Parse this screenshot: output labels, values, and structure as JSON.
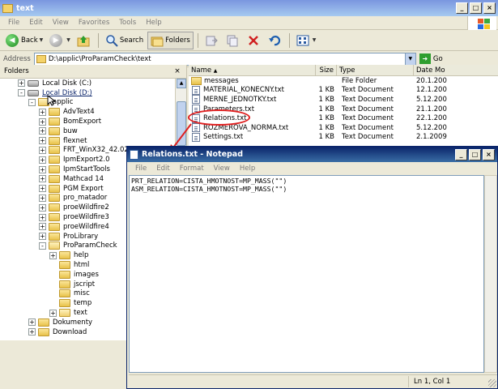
{
  "explorer": {
    "title": "text",
    "menu": [
      "File",
      "Edit",
      "View",
      "Favorites",
      "Tools",
      "Help"
    ],
    "toolbar": {
      "back_label": "Back",
      "search_label": "Search",
      "folders_label": "Folders"
    },
    "address": {
      "label": "Address",
      "value": "D:\\applic\\ProParamCheck\\text",
      "go_label": "Go"
    },
    "folders_pane": {
      "title": "Folders",
      "tree": [
        {
          "label": "Local Disk (C:)",
          "indent": 0,
          "exp": "+",
          "icon": "disk"
        },
        {
          "label": "Local Disk (D:)",
          "indent": 0,
          "exp": "-",
          "icon": "disk",
          "selected": true
        },
        {
          "label": "applic",
          "indent": 1,
          "exp": "-",
          "icon": "folder-open"
        },
        {
          "label": "AdvText4",
          "indent": 2,
          "exp": "+",
          "icon": "folder"
        },
        {
          "label": "BomExport",
          "indent": 2,
          "exp": "+",
          "icon": "folder"
        },
        {
          "label": "buw",
          "indent": 2,
          "exp": "+",
          "icon": "folder"
        },
        {
          "label": "flexnet",
          "indent": 2,
          "exp": "+",
          "icon": "folder"
        },
        {
          "label": "FRT_WinX32_42.02",
          "indent": 2,
          "exp": "+",
          "icon": "folder"
        },
        {
          "label": "IpmExport2.0",
          "indent": 2,
          "exp": "+",
          "icon": "folder"
        },
        {
          "label": "IpmStartTools",
          "indent": 2,
          "exp": "+",
          "icon": "folder"
        },
        {
          "label": "Mathcad 14",
          "indent": 2,
          "exp": "+",
          "icon": "folder"
        },
        {
          "label": "PGM Export",
          "indent": 2,
          "exp": "+",
          "icon": "folder"
        },
        {
          "label": "pro_matador",
          "indent": 2,
          "exp": "+",
          "icon": "folder"
        },
        {
          "label": "proeWildfire2",
          "indent": 2,
          "exp": "+",
          "icon": "folder"
        },
        {
          "label": "proeWildfire3",
          "indent": 2,
          "exp": "+",
          "icon": "folder"
        },
        {
          "label": "proeWildfire4",
          "indent": 2,
          "exp": "+",
          "icon": "folder"
        },
        {
          "label": "ProLibrary",
          "indent": 2,
          "exp": "+",
          "icon": "folder"
        },
        {
          "label": "ProParamCheck",
          "indent": 2,
          "exp": "-",
          "icon": "folder-open"
        },
        {
          "label": "help",
          "indent": 3,
          "exp": "+",
          "icon": "folder"
        },
        {
          "label": "html",
          "indent": 3,
          "exp": "",
          "icon": "folder"
        },
        {
          "label": "images",
          "indent": 3,
          "exp": "",
          "icon": "folder"
        },
        {
          "label": "jscript",
          "indent": 3,
          "exp": "",
          "icon": "folder"
        },
        {
          "label": "misc",
          "indent": 3,
          "exp": "",
          "icon": "folder"
        },
        {
          "label": "temp",
          "indent": 3,
          "exp": "",
          "icon": "folder"
        },
        {
          "label": "text",
          "indent": 3,
          "exp": "+",
          "icon": "folder-open"
        },
        {
          "label": "Dokumenty",
          "indent": 1,
          "exp": "+",
          "icon": "folder"
        },
        {
          "label": "Download",
          "indent": 1,
          "exp": "+",
          "icon": "folder"
        }
      ]
    },
    "file_list": {
      "columns": [
        "Name",
        "Size",
        "Type",
        "Date Mo"
      ],
      "files": [
        {
          "name": "messages",
          "size": "",
          "type": "File Folder",
          "date": "20.1.200",
          "kind": "folder"
        },
        {
          "name": "MATERIAL_KONECNY.txt",
          "size": "1 KB",
          "type": "Text Document",
          "date": "12.1.200",
          "kind": "doc"
        },
        {
          "name": "MERNE_JEDNOTKY.txt",
          "size": "1 KB",
          "type": "Text Document",
          "date": "5.12.200",
          "kind": "doc"
        },
        {
          "name": "Parameters.txt",
          "size": "1 KB",
          "type": "Text Document",
          "date": "21.1.200",
          "kind": "doc"
        },
        {
          "name": "Relations.txt",
          "size": "1 KB",
          "type": "Text Document",
          "date": "22.1.200",
          "kind": "doc"
        },
        {
          "name": "ROZMEROVA_NORMA.txt",
          "size": "1 KB",
          "type": "Text Document",
          "date": "5.12.200",
          "kind": "doc"
        },
        {
          "name": "Settings.txt",
          "size": "1 KB",
          "type": "Text Document",
          "date": "2.1.2009",
          "kind": "doc"
        }
      ]
    }
  },
  "notepad": {
    "title": "Relations.txt - Notepad",
    "menu": [
      "File",
      "Edit",
      "Format",
      "View",
      "Help"
    ],
    "lines": [
      "PRT_RELATION=CISTA_HMOTNOST=MP_MASS(\"\")",
      "ASM_RELATION=CISTA_HMOTNOST=MP_MASS(\"\")"
    ],
    "status": "Ln 1, Col 1"
  },
  "colors": {
    "annotation": "#E02020",
    "titlebar_active": "#0A246A"
  }
}
